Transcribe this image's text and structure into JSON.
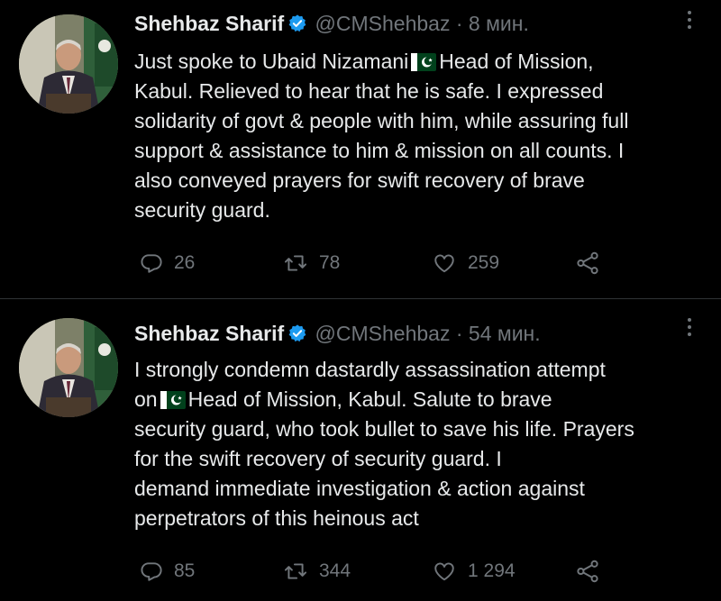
{
  "tweets": [
    {
      "author_name": "Shehbaz Sharif",
      "handle": "@CMShehbaz",
      "separator": "·",
      "time": "8 мин.",
      "text_lines": [
        "Just spoke to Ubaid Nizamani",
        "Head of Mission,",
        "Kabul. Relieved to hear that he is safe. I expressed",
        "solidarity of govt & people with him, while assuring full",
        "support & assistance to him & mission on all counts. I",
        "also conveyed prayers for swift recovery of brave",
        "security guard."
      ],
      "flag_icon": "pakistan-flag-emoji",
      "replies": "26",
      "retweets": "78",
      "likes": "259"
    },
    {
      "author_name": "Shehbaz Sharif",
      "handle": "@CMShehbaz",
      "separator": "·",
      "time": "54 мин.",
      "text_lines": [
        "I strongly condemn dastardly assassination attempt",
        "on",
        "Head of Mission, Kabul. Salute to brave",
        "security guard, who took bullet to save his life. Prayers",
        "for the swift recovery of security guard. I",
        "demand immediate investigation & action against",
        "perpetrators of this heinous act"
      ],
      "flag_icon": "pakistan-flag-emoji",
      "replies": "85",
      "retweets": "344",
      "likes": "1 294"
    }
  ],
  "colors": {
    "background": "#000000",
    "text": "#e7e9ea",
    "muted": "#71767b",
    "verified": "#1d9bf0",
    "divider": "#2f3336",
    "flag_green": "#01411c"
  },
  "icons": {
    "verified": "verified-badge-icon",
    "more": "more-dots-icon",
    "reply": "reply-icon",
    "retweet": "retweet-icon",
    "like": "heart-icon",
    "share": "share-icon"
  }
}
